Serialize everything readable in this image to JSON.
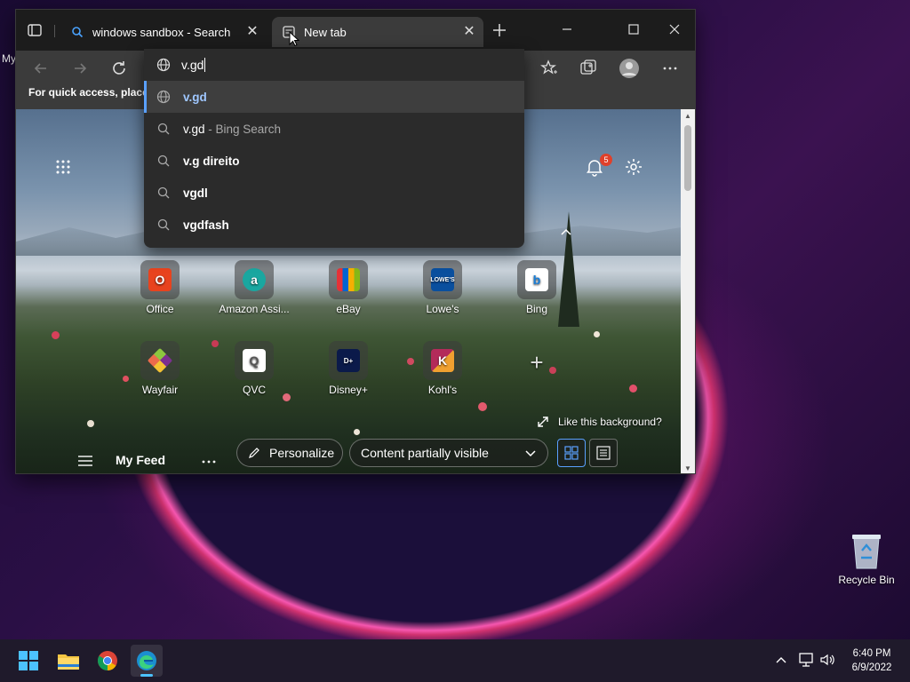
{
  "desktop": {
    "partial_text": "My",
    "recycle_bin": "Recycle Bin"
  },
  "browser": {
    "tabs": [
      {
        "title": "windows sandbox - Search",
        "icon": "search-icon"
      },
      {
        "title": "New tab",
        "icon": "new-tab-page-icon",
        "active": true
      }
    ],
    "address_value": "v.gd",
    "favorites_hint": "For quick access, place y",
    "suggestions": [
      {
        "bold": "v.gd",
        "extra": "",
        "icon": "globe-icon",
        "selected": true
      },
      {
        "bold": "v.gd",
        "extra": " - Bing Search",
        "icon": "search-icon"
      },
      {
        "bold": "v.g direito",
        "extra": "",
        "icon": "search-icon"
      },
      {
        "bold": "vgdl",
        "extra": "",
        "icon": "search-icon"
      },
      {
        "bold": "vgdfash",
        "extra": "",
        "icon": "search-icon"
      }
    ],
    "notification_count": "5",
    "quick_links_row1": [
      {
        "label": "Office",
        "color": "#e8431e"
      },
      {
        "label": "Amazon Assi...",
        "color": "#1aa7a0"
      },
      {
        "label": "eBay",
        "color": "#333333"
      },
      {
        "label": "Lowe's",
        "color": "#0a4f9e"
      },
      {
        "label": "Bing",
        "color": "#ffffff"
      }
    ],
    "quick_links_row2": [
      {
        "label": "Wayfair",
        "color": "#7b2f8f"
      },
      {
        "label": "QVC",
        "color": "#ffffff"
      },
      {
        "label": "Disney+",
        "color": "#0b1a4a"
      },
      {
        "label": "Kohl's",
        "color": "#b32b5a"
      }
    ],
    "like_background": "Like this background?",
    "feed": {
      "title": "My Feed",
      "personalize": "Personalize",
      "visibility": "Content partially visible"
    }
  },
  "taskbar": {
    "time": "6:40 PM",
    "date": "6/9/2022"
  },
  "colors": {
    "accent": "#5aa0ff",
    "badge": "#e0402a"
  }
}
